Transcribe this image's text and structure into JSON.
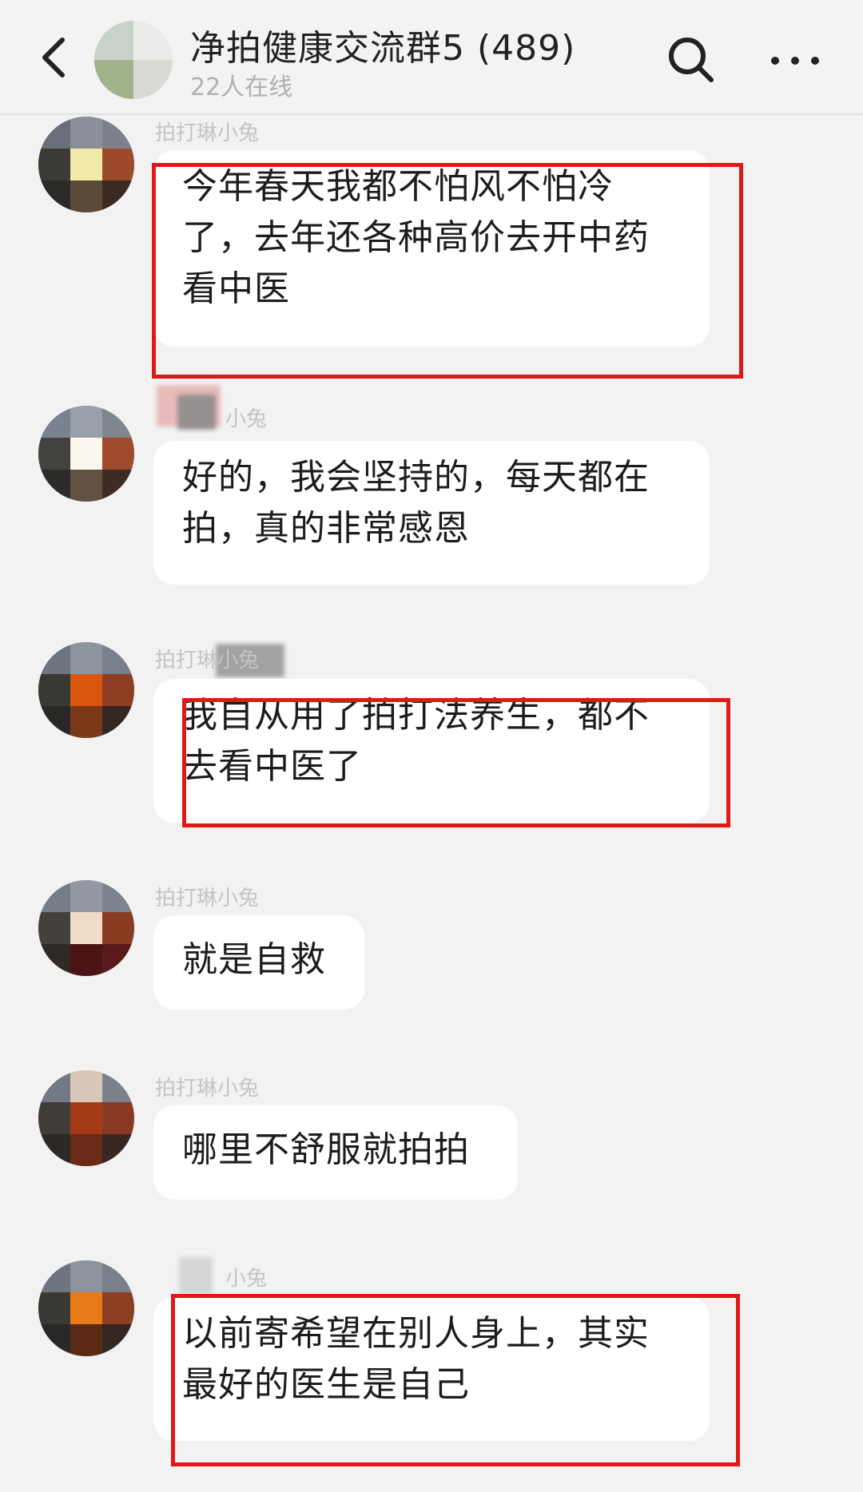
{
  "header": {
    "title": "净拍健康交流群5 (489)",
    "online": "22人在线",
    "back_icon": "chevron-left-icon",
    "search_icon": "search-icon",
    "more_icon": "more-dots-icon"
  },
  "messages": [
    {
      "sender": "拍打琳小兔",
      "lines": [
        "今年春天我都不怕风不怕冷",
        "了，去年还各种高价去开中药",
        "看中医"
      ],
      "highlighted": true
    },
    {
      "sender": "小兔",
      "lines": [
        "好的，我会坚持的，每天都在",
        "拍，真的非常感恩"
      ],
      "highlighted": false
    },
    {
      "sender": "拍打琳小兔",
      "lines": [
        "我自从用了拍打法养生，都不",
        "去看中医了"
      ],
      "highlighted": true
    },
    {
      "sender": "拍打琳小兔",
      "lines": [
        "就是自救"
      ],
      "highlighted": false
    },
    {
      "sender": "拍打琳小兔",
      "lines": [
        "哪里不舒服就拍拍"
      ],
      "highlighted": false
    },
    {
      "sender": "小兔",
      "lines": [
        "以前寄希望在别人身上，其实",
        "最好的医生是自己"
      ],
      "highlighted": true
    }
  ],
  "colors": {
    "background": "#f2f2f2",
    "bubble": "#ffffff",
    "highlight_box": "#e01818"
  }
}
